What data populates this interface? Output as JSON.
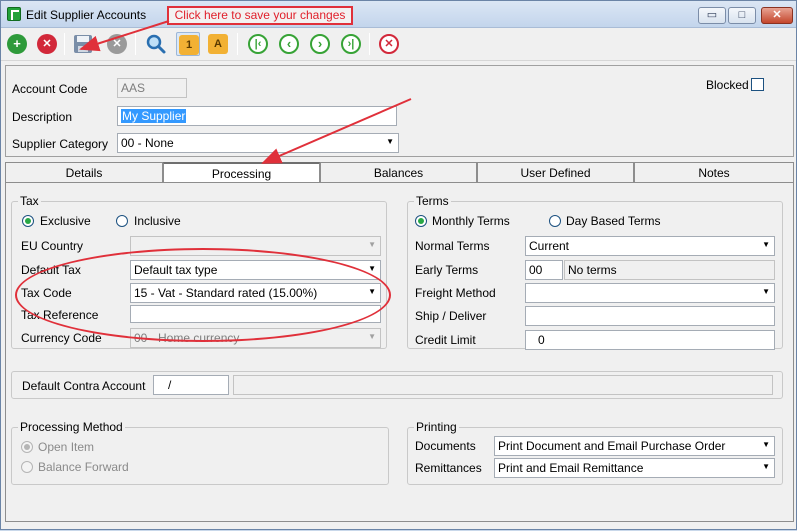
{
  "window": {
    "title": "Edit Supplier Accounts",
    "controls": {
      "minimize": "▭",
      "maximize": "□",
      "close": "✕"
    }
  },
  "annotation": {
    "text": "Click here to save your changes"
  },
  "toolbar": {
    "buttons": [
      {
        "name": "new",
        "icon": "plus-icon",
        "glyph": "+",
        "color": "#2e9a3a"
      },
      {
        "name": "delete",
        "icon": "delete-icon",
        "glyph": "✕",
        "color": "#d2283a"
      },
      {
        "name": "save",
        "icon": "save-icon",
        "glyph": "",
        "color": "#7a8ea8"
      },
      {
        "name": "cancel",
        "icon": "cancel-icon",
        "glyph": "✕",
        "color": "#9a9a9a"
      },
      {
        "name": "find",
        "icon": "search-icon",
        "glyph": "",
        "color": "#2a6fb0"
      },
      {
        "name": "sort-by-code",
        "icon": "sort-code-icon",
        "glyph": "1",
        "color": "#f2b134"
      },
      {
        "name": "sort-by-name",
        "icon": "sort-name-icon",
        "glyph": "A",
        "color": "#f2b134"
      },
      {
        "name": "first",
        "icon": "first-record-icon",
        "glyph": "|‹",
        "color": "#37a336"
      },
      {
        "name": "previous",
        "icon": "previous-record-icon",
        "glyph": "‹",
        "color": "#37a336"
      },
      {
        "name": "next",
        "icon": "next-record-icon",
        "glyph": "›",
        "color": "#37a336"
      },
      {
        "name": "last",
        "icon": "last-record-icon",
        "glyph": "›|",
        "color": "#37a336"
      },
      {
        "name": "close",
        "icon": "close-record-icon",
        "glyph": "✕",
        "color": "#d2283a"
      }
    ]
  },
  "header": {
    "account_code_label": "Account Code",
    "account_code_value": "AAS",
    "description_label": "Description",
    "description_value": "My Supplier",
    "category_label": "Supplier Category",
    "category_value": "00 - None",
    "blocked_label": "Blocked"
  },
  "tabs": [
    "Details",
    "Processing",
    "Balances",
    "User Defined",
    "Notes"
  ],
  "tax": {
    "group_label": "Tax",
    "exclusive_label": "Exclusive",
    "inclusive_label": "Inclusive",
    "eu_country_label": "EU Country",
    "eu_country_value": "",
    "default_tax_label": "Default Tax",
    "default_tax_value": "Default tax type",
    "tax_code_label": "Tax Code",
    "tax_code_value": "15 - Vat - Standard rated (15.00%)",
    "tax_reference_label": "Tax Reference",
    "tax_reference_value": "",
    "currency_code_label": "Currency Code",
    "currency_code_value": "00 - Home currency"
  },
  "terms": {
    "group_label": "Terms",
    "monthly_label": "Monthly Terms",
    "day_based_label": "Day Based Terms",
    "normal_terms_label": "Normal Terms",
    "normal_terms_value": "Current",
    "early_terms_label": "Early Terms",
    "early_terms_days": "00",
    "early_terms_desc": "No terms",
    "freight_label": "Freight Method",
    "freight_value": "",
    "ship_label": "Ship / Deliver",
    "ship_value": "",
    "credit_limit_label": "Credit Limit",
    "credit_limit_value": "0"
  },
  "contra": {
    "label": "Default Contra Account",
    "code_value": "/",
    "desc_value": ""
  },
  "processing_method": {
    "group_label": "Processing Method",
    "open_item_label": "Open Item",
    "balance_forward_label": "Balance Forward"
  },
  "printing": {
    "group_label": "Printing",
    "documents_label": "Documents",
    "documents_value": "Print Document and Email Purchase Order",
    "remittances_label": "Remittances",
    "remittances_value": "Print and Email Remittance"
  },
  "colors": {
    "annotation_red": "#e0303a",
    "radio_green": "#28a745",
    "selection_blue": "#3399ff"
  }
}
